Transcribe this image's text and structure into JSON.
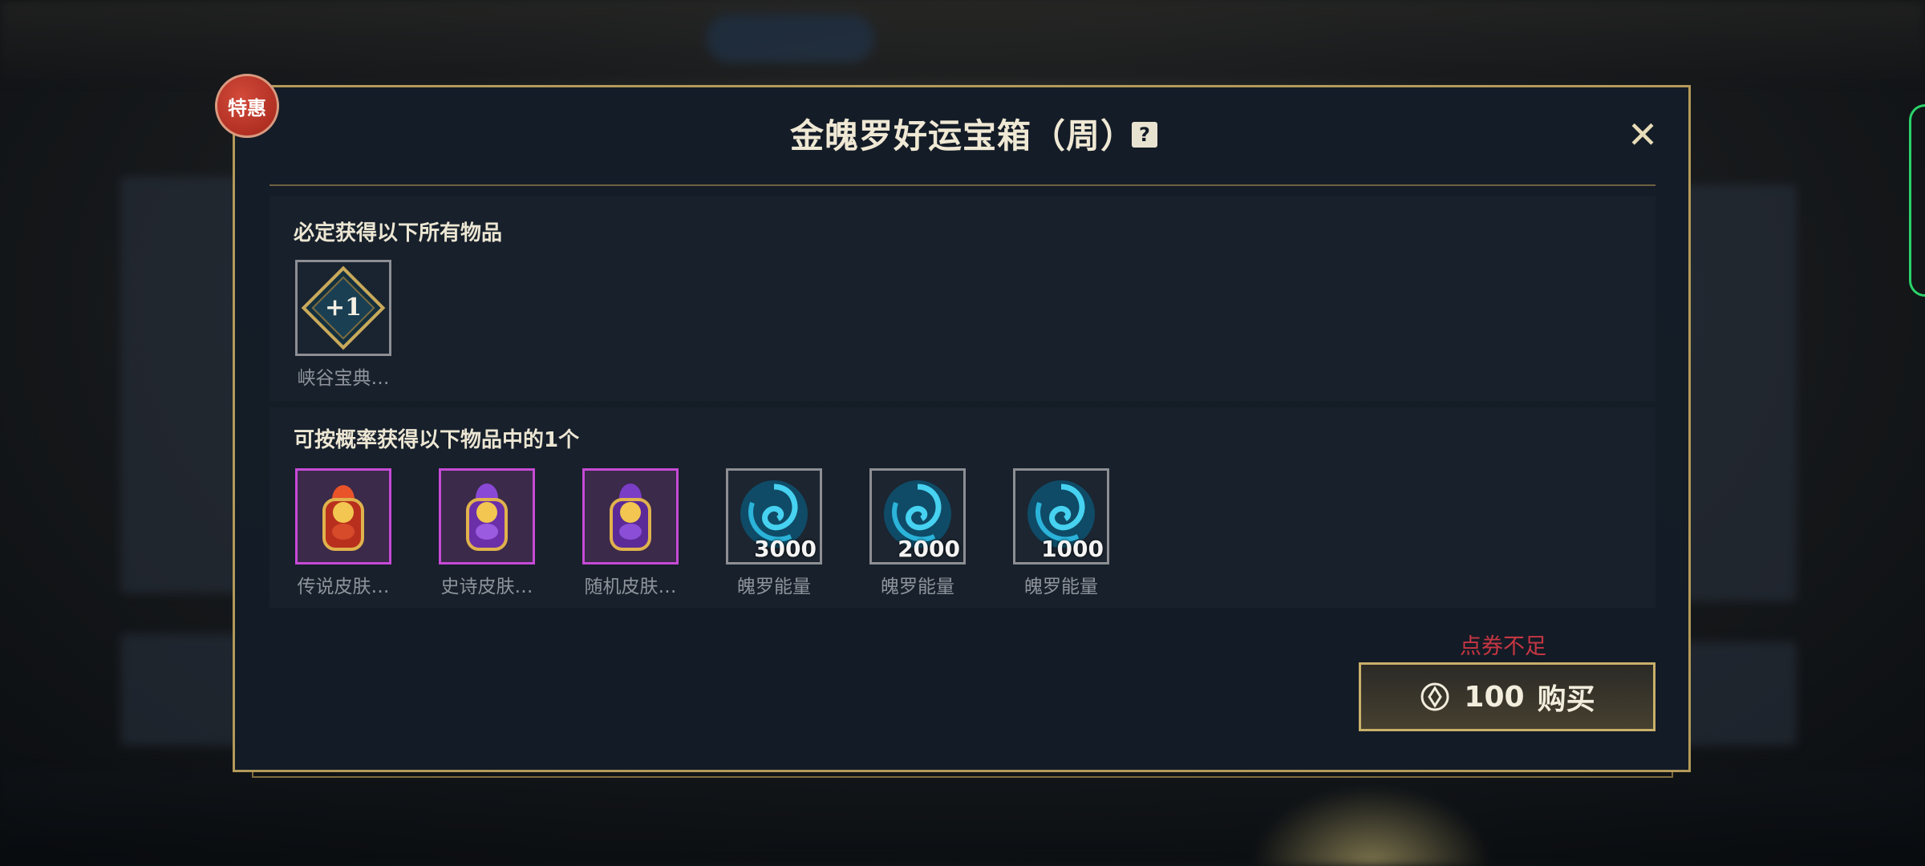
{
  "badge": "特惠",
  "title": "金魄罗好运宝箱（周）",
  "help_icon": "question-icon",
  "close_icon": "close-icon",
  "guaranteed": {
    "title": "必定获得以下所有物品",
    "items": [
      {
        "label": "峡谷宝典…",
        "badge_text": "+1",
        "icon": "battle-pass-level-icon"
      }
    ]
  },
  "random": {
    "title": "可按概率获得以下物品中的1个",
    "items": [
      {
        "label": "传说皮肤…",
        "icon": "legendary-skin-chest-icon",
        "qty": ""
      },
      {
        "label": "史诗皮肤…",
        "icon": "epic-skin-chest-icon",
        "qty": ""
      },
      {
        "label": "随机皮肤…",
        "icon": "random-skin-chest-icon",
        "qty": ""
      },
      {
        "label": "魄罗能量",
        "icon": "poro-energy-icon",
        "qty": "3000"
      },
      {
        "label": "魄罗能量",
        "icon": "poro-energy-icon",
        "qty": "2000"
      },
      {
        "label": "魄罗能量",
        "icon": "poro-energy-icon",
        "qty": "1000"
      }
    ]
  },
  "purchase": {
    "warning": "点券不足",
    "price": "100",
    "label": "购买",
    "currency_icon": "coupon-icon"
  },
  "colors": {
    "frame_gold": "#b39a5a",
    "warning_red": "#c73643",
    "purple_rarity": "#c64ad6"
  }
}
